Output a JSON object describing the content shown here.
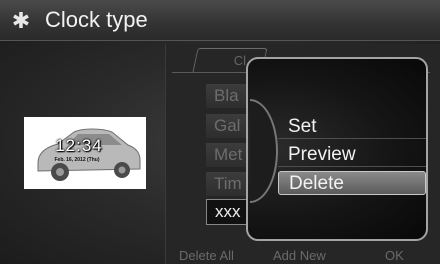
{
  "header": {
    "title": "Clock type",
    "icon": "gear-icon"
  },
  "preview": {
    "time": "12:34",
    "date": "Feb. 16, 2012 (Thu)"
  },
  "list": {
    "tab_label": "Cl",
    "items": [
      {
        "label": "Bla"
      },
      {
        "label": "Gal"
      },
      {
        "label": "Met"
      },
      {
        "label": "Tim"
      }
    ],
    "selected_item": "xxx"
  },
  "bottom_bar": {
    "delete_all": "Delete All",
    "add_new": "Add New",
    "ok": "OK"
  },
  "menu": {
    "items": [
      {
        "label": "Set"
      },
      {
        "label": "Preview"
      },
      {
        "label": "Delete",
        "active": true
      }
    ]
  }
}
